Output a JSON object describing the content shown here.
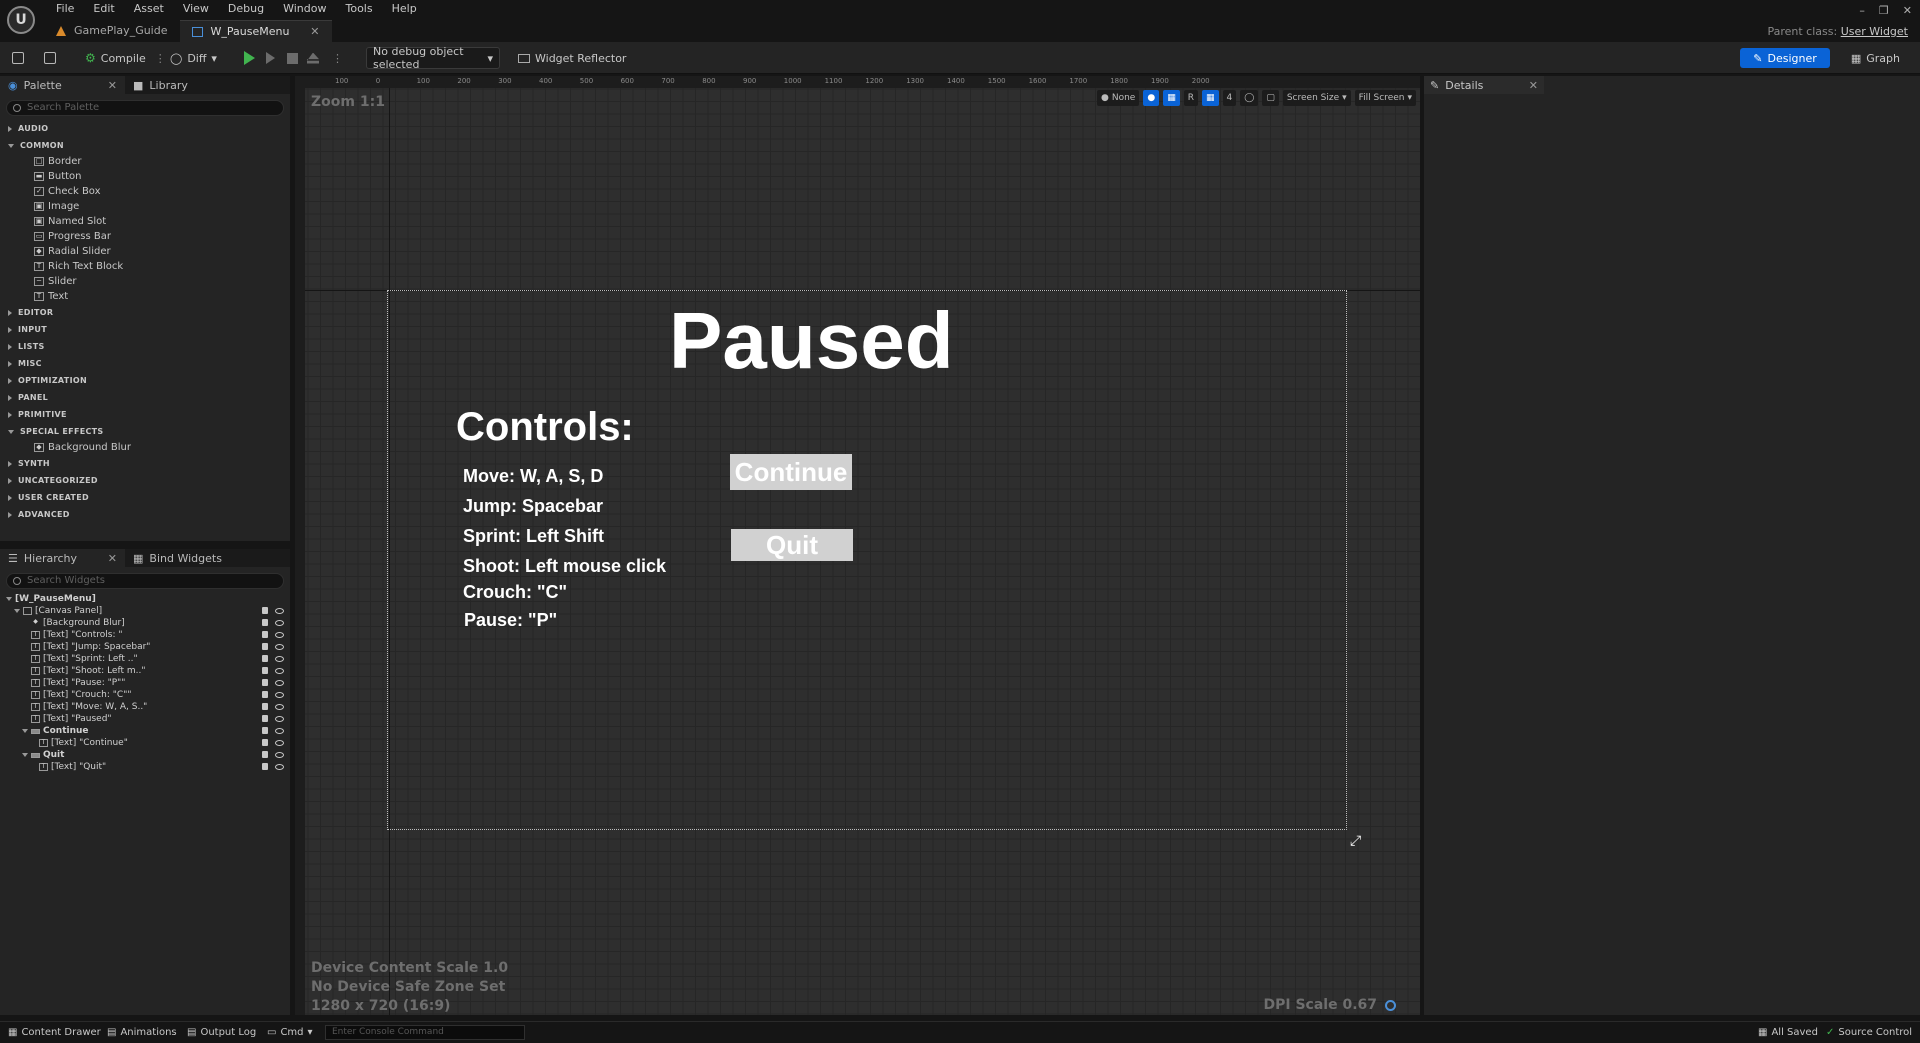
{
  "menu": [
    "File",
    "Edit",
    "Asset",
    "View",
    "Debug",
    "Window",
    "Tools",
    "Help"
  ],
  "tabs": [
    {
      "label": "GamePlay_Guide",
      "active": false
    },
    {
      "label": "W_PauseMenu",
      "active": true
    }
  ],
  "parent_class": {
    "label": "Parent class:",
    "value": "User Widget"
  },
  "toolbar": {
    "compile_label": "Compile",
    "diff_label": "Diff",
    "debug_select": "No debug object selected",
    "widget_reflector_label": "Widget Reflector",
    "designer_label": "Designer",
    "graph_label": "Graph"
  },
  "palette": {
    "tab_palette": "Palette",
    "tab_library": "Library",
    "search_placeholder": "Search Palette",
    "categories": [
      {
        "name": "AUDIO",
        "expanded": false,
        "items": []
      },
      {
        "name": "COMMON",
        "expanded": true,
        "items": [
          {
            "label": "Border",
            "icon": "border-icon"
          },
          {
            "label": "Button",
            "icon": "button-icon"
          },
          {
            "label": "Check Box",
            "icon": "checkbox-icon"
          },
          {
            "label": "Image",
            "icon": "image-icon"
          },
          {
            "label": "Named Slot",
            "icon": "named-slot-icon"
          },
          {
            "label": "Progress Bar",
            "icon": "progress-bar-icon"
          },
          {
            "label": "Radial Slider",
            "icon": "radial-slider-icon"
          },
          {
            "label": "Rich Text Block",
            "icon": "rich-text-icon"
          },
          {
            "label": "Slider",
            "icon": "slider-icon"
          },
          {
            "label": "Text",
            "icon": "text-icon"
          }
        ]
      },
      {
        "name": "EDITOR",
        "expanded": false,
        "items": []
      },
      {
        "name": "INPUT",
        "expanded": false,
        "items": []
      },
      {
        "name": "LISTS",
        "expanded": false,
        "items": []
      },
      {
        "name": "MISC",
        "expanded": false,
        "items": []
      },
      {
        "name": "OPTIMIZATION",
        "expanded": false,
        "items": []
      },
      {
        "name": "PANEL",
        "expanded": false,
        "items": []
      },
      {
        "name": "PRIMITIVE",
        "expanded": false,
        "items": []
      },
      {
        "name": "SPECIAL EFFECTS",
        "expanded": true,
        "items": [
          {
            "label": "Background Blur",
            "icon": "background-blur-icon"
          }
        ]
      },
      {
        "name": "SYNTH",
        "expanded": false,
        "items": []
      },
      {
        "name": "UNCATEGORIZED",
        "expanded": false,
        "items": []
      },
      {
        "name": "USER CREATED",
        "expanded": false,
        "items": []
      },
      {
        "name": "ADVANCED",
        "expanded": false,
        "items": []
      }
    ]
  },
  "hierarchy": {
    "tab_hierarchy": "Hierarchy",
    "tab_bind": "Bind Widgets",
    "search_placeholder": "Search Widgets",
    "rows": [
      {
        "label": "[W_PauseMenu]",
        "indent": 0,
        "bold": true,
        "arrow": "down",
        "icon": ""
      },
      {
        "label": "[Canvas Panel]",
        "indent": 1,
        "bold": false,
        "arrow": "down",
        "icon": "canvas"
      },
      {
        "label": "[Background Blur]",
        "indent": 2,
        "bold": false,
        "arrow": "",
        "icon": "blur"
      },
      {
        "label": "[Text] \"Controls: \"",
        "indent": 2,
        "bold": false,
        "arrow": "",
        "icon": "T"
      },
      {
        "label": "[Text] \"Jump: Spacebar\"",
        "indent": 2,
        "bold": false,
        "arrow": "",
        "icon": "T"
      },
      {
        "label": "[Text] \"Sprint: Left ..\"",
        "indent": 2,
        "bold": false,
        "arrow": "",
        "icon": "T"
      },
      {
        "label": "[Text] \"Shoot: Left m..\"",
        "indent": 2,
        "bold": false,
        "arrow": "",
        "icon": "T"
      },
      {
        "label": "[Text] \"Pause: \"P\"\"",
        "indent": 2,
        "bold": false,
        "arrow": "",
        "icon": "T"
      },
      {
        "label": "[Text] \"Crouch: \"C\"\"",
        "indent": 2,
        "bold": false,
        "arrow": "",
        "icon": "T"
      },
      {
        "label": "[Text] \"Move: W, A, S..\"",
        "indent": 2,
        "bold": false,
        "arrow": "",
        "icon": "T"
      },
      {
        "label": "[Text] \"Paused\"",
        "indent": 2,
        "bold": false,
        "arrow": "",
        "icon": "T"
      },
      {
        "label": "Continue",
        "indent": 2,
        "bold": true,
        "arrow": "down",
        "icon": "btn"
      },
      {
        "label": "[Text] \"Continue\"",
        "indent": 3,
        "bold": false,
        "arrow": "",
        "icon": "T"
      },
      {
        "label": "Quit",
        "indent": 2,
        "bold": true,
        "arrow": "down",
        "icon": "btn"
      },
      {
        "label": "[Text] \"Quit\"",
        "indent": 3,
        "bold": false,
        "arrow": "",
        "icon": "T"
      }
    ]
  },
  "designer": {
    "zoom": "Zoom 1:1",
    "ruler_labels": [
      "100",
      "0",
      "100",
      "200",
      "300",
      "400",
      "500",
      "600",
      "700",
      "800",
      "900",
      "1000",
      "1100",
      "1200",
      "1300",
      "1400",
      "1500",
      "1600",
      "1700",
      "1800",
      "1900",
      "2000"
    ],
    "view_none": "None",
    "view_r": "R",
    "view_grid": "4",
    "screen_size": "Screen Size",
    "fill_screen": "Fill Screen",
    "device_scale": "Device Content Scale 1.0",
    "safe_zone": "No Device Safe Zone Set",
    "resolution": "1280 x 720 (16:9)",
    "dpi_scale": "DPI Scale 0.67"
  },
  "widget": {
    "title": "Paused",
    "controls_heading": "Controls:",
    "controls": [
      "Move: W, A, S, D",
      "Jump: Spacebar",
      "Sprint: Left Shift",
      "Shoot: Left mouse click",
      "Crouch: \"C\"",
      "Pause: \"P\""
    ],
    "continue_label": "Continue",
    "quit_label": "Quit"
  },
  "details": {
    "tab": "Details"
  },
  "statusbar": {
    "content_drawer": "Content Drawer",
    "animations": "Animations",
    "output_log": "Output Log",
    "cmd": "Cmd",
    "console_placeholder": "Enter Console Command",
    "all_saved": "All Saved",
    "source_control": "Source Control"
  },
  "colors": {
    "accent": "#0a63d6",
    "play": "#41b44f",
    "button_bg": "#d1d1d1"
  }
}
